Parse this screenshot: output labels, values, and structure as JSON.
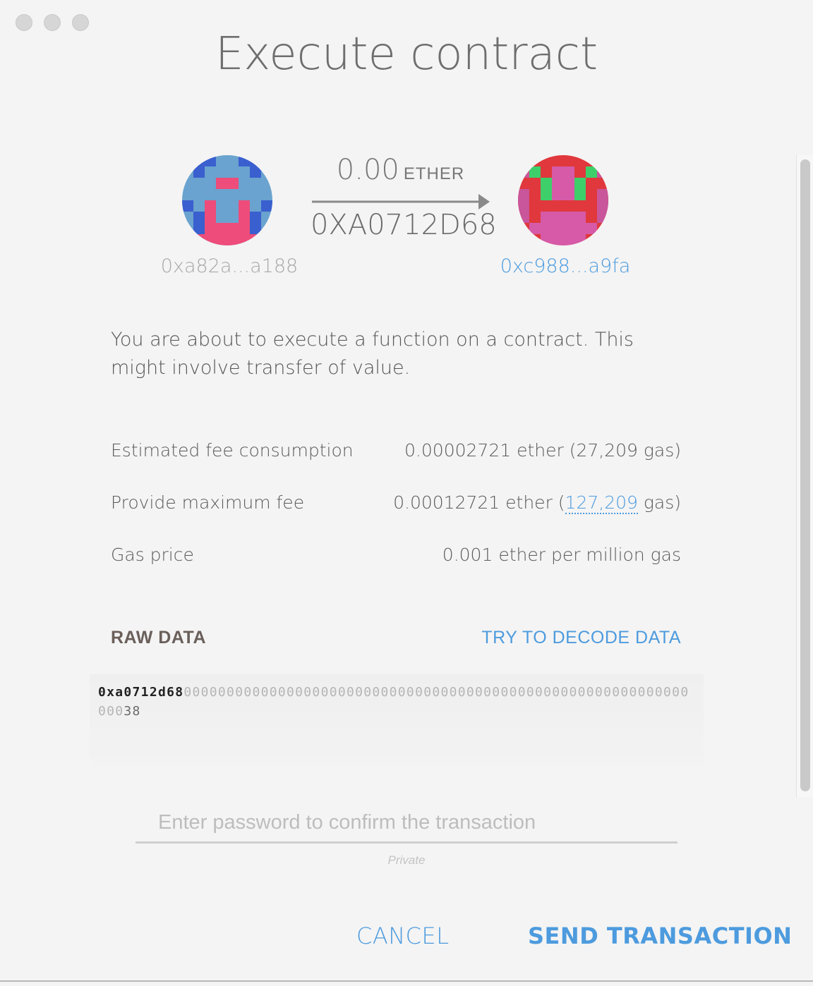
{
  "window": {
    "title": "Execute contract"
  },
  "transaction": {
    "from_address": "0xa82a...a188",
    "to_address": "0xc988...a9fa",
    "amount": "0.00",
    "amount_unit": "ETHER",
    "contract_label": "0XA0712D68"
  },
  "identicons": {
    "from_icon": "identicon-from",
    "to_icon": "identicon-to"
  },
  "description": "You are about to execute a function on a contract. This might involve transfer of value.",
  "fees": {
    "estimated_label": "Estimated fee consumption",
    "estimated_value": "0.00002721 ether (27,209 gas)",
    "max_label": "Provide maximum fee",
    "max_value_prefix": "0.00012721 ether (",
    "max_value_gas": "127,209",
    "max_value_suffix": " gas)",
    "gas_price_label": "Gas price",
    "gas_price_value": "0.001 ether per million gas"
  },
  "raw_data": {
    "label": "RAW DATA",
    "decode_button": "TRY TO DECODE DATA",
    "method": "0xa0712d68",
    "padding": "00000000000000000000000000000000000000000000000000000000000000",
    "tail": "38"
  },
  "password": {
    "placeholder": "Enter password to confirm the transaction",
    "hint": "Private"
  },
  "buttons": {
    "cancel": "CANCEL",
    "send": "SEND TRANSACTION"
  },
  "colors": {
    "accent": "#4d9bde",
    "background": "#f4f4f4"
  }
}
